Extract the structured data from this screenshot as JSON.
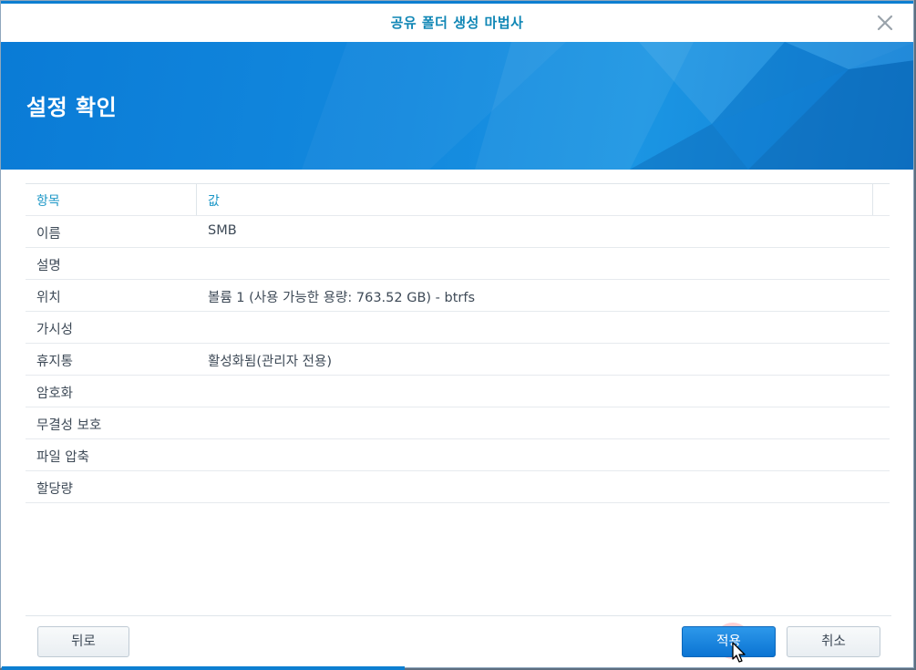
{
  "window": {
    "title": "공유 폴더 생성 마법사"
  },
  "banner": {
    "title": "설정 확인"
  },
  "table": {
    "headers": {
      "key": "항목",
      "value": "값"
    },
    "rows": [
      {
        "key": "이름",
        "value": "SMB"
      },
      {
        "key": "설명",
        "value": ""
      },
      {
        "key": "위치",
        "value": "볼륨 1 (사용 가능한 용량: 763.52 GB) - btrfs"
      },
      {
        "key": "가시성",
        "value": ""
      },
      {
        "key": "휴지통",
        "value": "활성화됨(관리자 전용)"
      },
      {
        "key": "암호화",
        "value": ""
      },
      {
        "key": "무결성 보호",
        "value": ""
      },
      {
        "key": "파일 압축",
        "value": ""
      },
      {
        "key": "할당량",
        "value": ""
      }
    ]
  },
  "buttons": {
    "back": "뒤로",
    "apply": "적용",
    "cancel": "취소"
  },
  "colors": {
    "accent": "#0d7fd1",
    "title_text": "#0f86b5",
    "header_text": "#1a96c6"
  },
  "icons": {
    "close": "close-icon",
    "cursor": "mouse-pointer-icon"
  }
}
